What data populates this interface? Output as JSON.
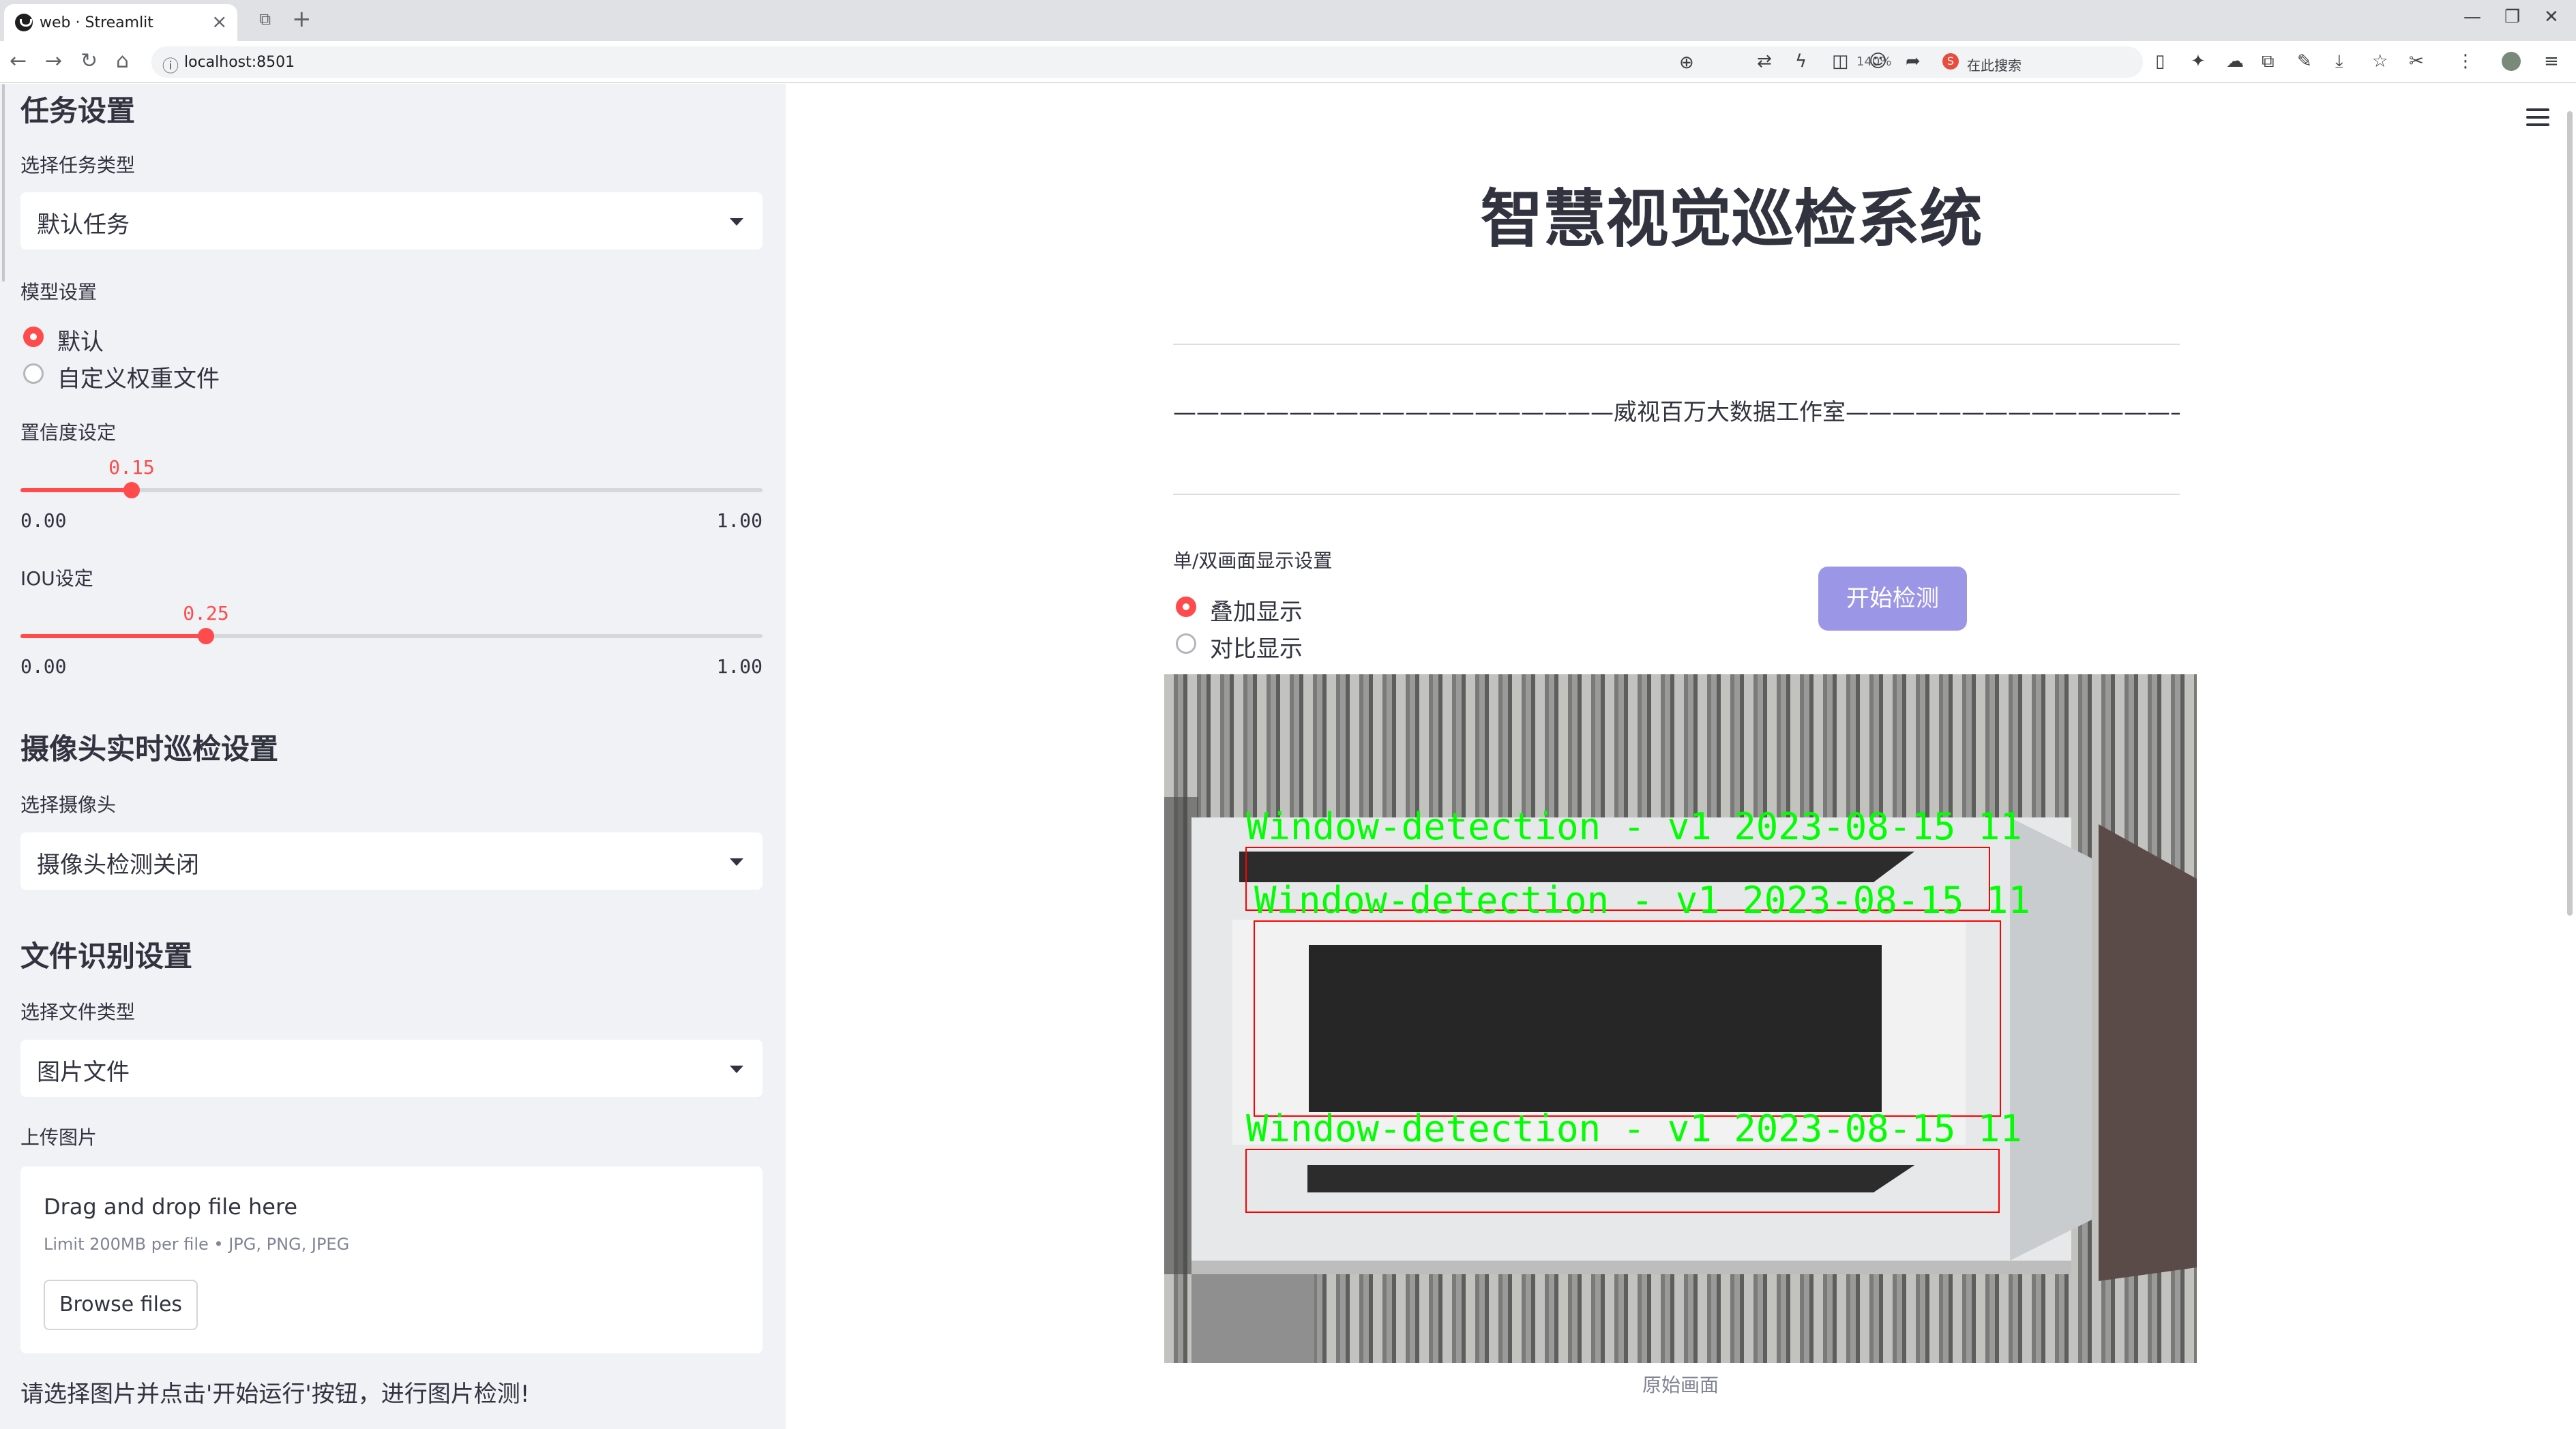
{
  "browser": {
    "tab_title": "web · Streamlit",
    "url": "localhost:8501",
    "zoom": "140%",
    "search_label": "在此搜索"
  },
  "sidebar": {
    "task_section": "任务设置",
    "task_type_label": "选择任务类型",
    "task_type_value": "默认任务",
    "model_label": "模型设置",
    "model_options": [
      "默认",
      "自定义权重文件"
    ],
    "model_selected": 0,
    "confidence_label": "置信度设定",
    "confidence": {
      "value": 0.15,
      "value_text": "0.15",
      "min": "0.00",
      "max": "1.00"
    },
    "iou_label": "IOU设定",
    "iou": {
      "value": 0.25,
      "value_text": "0.25",
      "min": "0.00",
      "max": "1.00"
    },
    "camera_section": "摄像头实时巡检设置",
    "camera_label": "选择摄像头",
    "camera_value": "摄像头检测关闭",
    "file_section": "文件识别设置",
    "file_type_label": "选择文件类型",
    "file_type_value": "图片文件",
    "upload_label": "上传图片",
    "upload_title": "Drag and drop file here",
    "upload_hint": "Limit 200MB per file • JPG, PNG, JPEG",
    "browse_button": "Browse files",
    "note": "请选择图片并点击'开始运行'按钮，进行图片检测!"
  },
  "main": {
    "title": "智慧视觉巡检系统",
    "subtitle": "———————————————————威视百万大数据工作室————————————————————",
    "display_label": "单/双画面显示设置",
    "display_options": [
      "叠加显示",
      "对比显示"
    ],
    "display_selected": 0,
    "start_button": "开始检测",
    "image_caption": "原始画面",
    "detections": [
      "Window-detection - v1 2023-08-15 11",
      "Window-detection - v1 2023-08-15 11",
      "Window-detection - v1 2023-08-15 11"
    ]
  },
  "colors": {
    "accent": "#ff4b4b",
    "sidebar_bg": "#f0f2f6",
    "button_bg": "#9b96e6",
    "detection_label": "#00ff00",
    "detection_box": "#ff0000"
  }
}
